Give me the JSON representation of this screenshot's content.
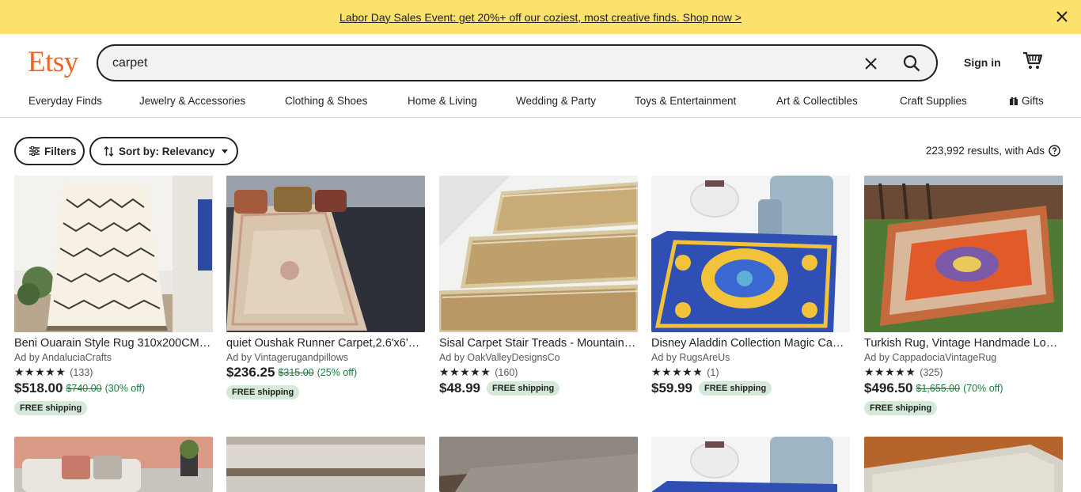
{
  "promo": {
    "text": "Labor Day Sales Event: get 20%+ off our coziest, most creative finds. Shop now >"
  },
  "header": {
    "logo": "Etsy",
    "search_value": "carpet",
    "signin": "Sign in",
    "icons": {
      "clear": "close-icon",
      "search": "search-icon",
      "cart": "cart-icon",
      "promo_close": "close-icon"
    }
  },
  "nav": {
    "items": [
      "Everyday Finds",
      "Jewelry & Accessories",
      "Clothing & Shoes",
      "Home & Living",
      "Wedding & Party",
      "Toys & Entertainment",
      "Art & Collectibles",
      "Craft Supplies",
      "Gifts"
    ]
  },
  "toolbar": {
    "filters": "Filters",
    "sort": "Sort by: Relevancy",
    "results": "223,992 results, with Ads"
  },
  "colors": {
    "brand": "#f1641e",
    "promo": "#fde16d",
    "sale": "#1a7c3a",
    "badge": "#d4e9d7"
  },
  "listings": [
    {
      "title": "Beni Ouarain Style Rug 310x200CM…",
      "shop": "Ad by AndaluciaCrafts",
      "stars": "★★★★★",
      "reviews": "(133)",
      "price": "$518.00",
      "orig": "$740.00",
      "disc": "(30% off)",
      "ship": "FREE shipping"
    },
    {
      "title": "quiet Oushak Runner Carpet,2.6'x6'…",
      "shop": "Ad by Vintagerugandpillows",
      "stars": "",
      "reviews": "",
      "price": "$236.25",
      "orig": "$315.00",
      "disc": "(25% off)",
      "ship": "FREE shipping"
    },
    {
      "title": "Sisal Carpet Stair Treads - Mountain…",
      "shop": "Ad by OakValleyDesignsCo",
      "stars": "★★★★★",
      "reviews": "(160)",
      "price": "$48.99",
      "orig": "",
      "disc": "",
      "ship": "FREE shipping"
    },
    {
      "title": "Disney Aladdin Collection Magic Ca…",
      "shop": "Ad by RugsAreUs",
      "stars": "★★★★★",
      "reviews": "(1)",
      "price": "$59.99",
      "orig": "",
      "disc": "",
      "ship": "FREE shipping"
    },
    {
      "title": "Turkish Rug, Vintage Handmade Lo…",
      "shop": "Ad by CappadociaVintageRug",
      "stars": "★★★★★",
      "reviews": "(325)",
      "price": "$496.50",
      "orig": "$1,655.00",
      "disc": "(70% off)",
      "ship": "FREE shipping"
    }
  ]
}
